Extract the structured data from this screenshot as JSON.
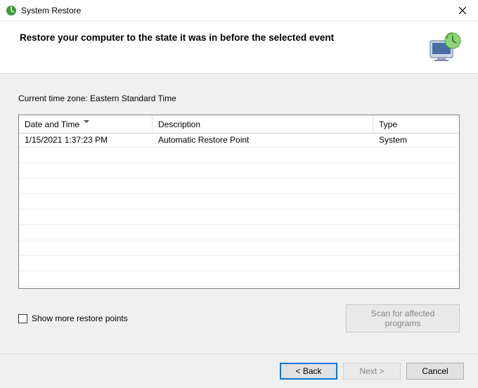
{
  "window": {
    "title": "System Restore"
  },
  "header": {
    "heading": "Restore your computer to the state it was in before the selected event"
  },
  "timezone_label": "Current time zone: Eastern Standard Time",
  "table": {
    "columns": {
      "date_time": "Date and Time",
      "description": "Description",
      "type": "Type"
    },
    "rows": [
      {
        "date_time": "1/15/2021 1:37:23 PM",
        "description": "Automatic Restore Point",
        "type": "System"
      }
    ]
  },
  "show_more": {
    "label": "Show more restore points",
    "checked": false
  },
  "scan_button": "Scan for affected programs",
  "footer": {
    "back": "< Back",
    "next": "Next >",
    "cancel": "Cancel"
  }
}
